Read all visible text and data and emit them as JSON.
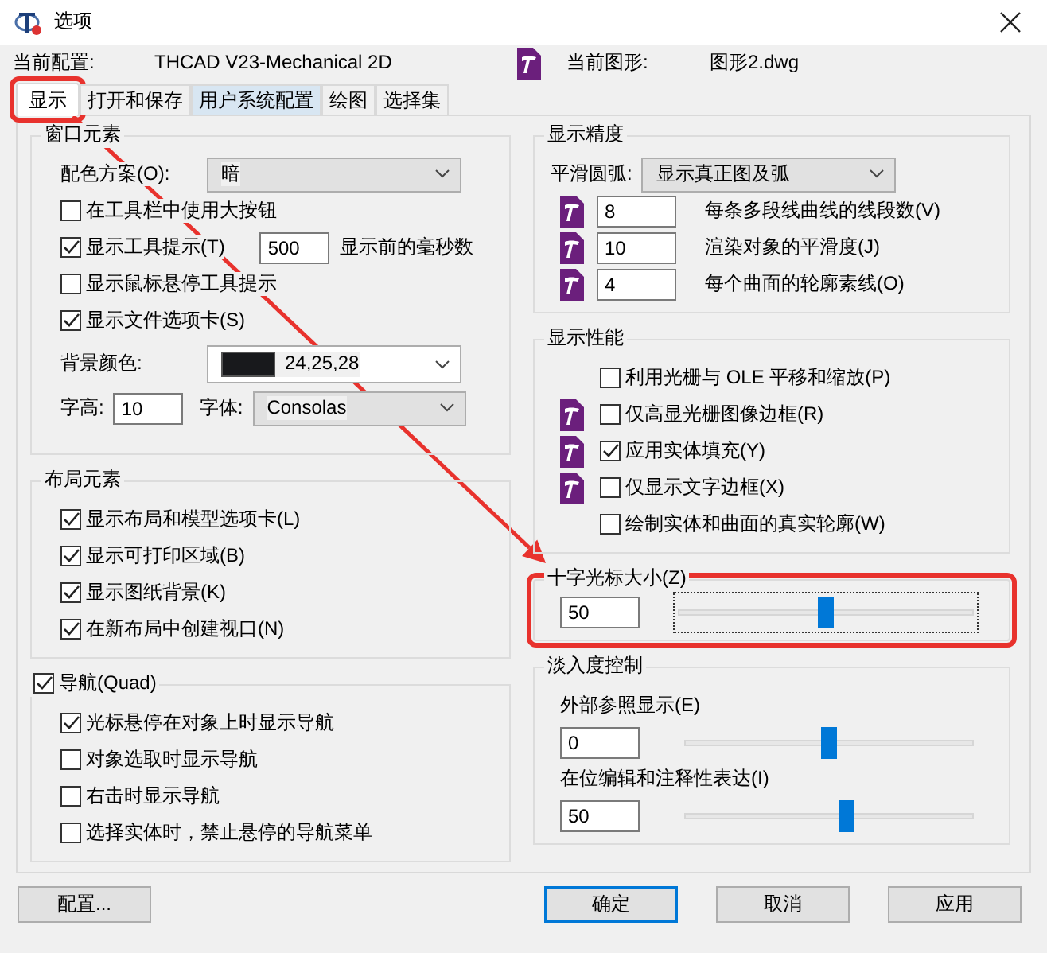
{
  "window": {
    "title": "选项"
  },
  "header": {
    "profile_label": "当前配置:",
    "profile": "THCAD V23-Mechanical 2D",
    "drawing_label": "当前图形:",
    "drawing": "图形2.dwg"
  },
  "tabs": [
    {
      "label": "显示",
      "selected": true,
      "hover": false,
      "highlighted": true
    },
    {
      "label": "打开和保存",
      "selected": false,
      "hover": false,
      "highlighted": false
    },
    {
      "label": "用户系统配置",
      "selected": false,
      "hover": true,
      "highlighted": false
    },
    {
      "label": "绘图",
      "selected": false,
      "hover": false,
      "highlighted": false
    },
    {
      "label": "选择集",
      "selected": false,
      "hover": false,
      "highlighted": false
    }
  ],
  "annotation_arrow": true,
  "window_elements": {
    "title": "窗口元素",
    "color_scheme": {
      "label": "配色方案(O):",
      "value": "暗"
    },
    "options": [
      {
        "label": "在工具栏中使用大按钮",
        "checked": false
      },
      {
        "label": "显示工具提示(T)",
        "checked": true,
        "value": "500",
        "suffix": "显示前的毫秒数"
      },
      {
        "label": "显示鼠标悬停工具提示",
        "checked": false
      },
      {
        "label": "显示文件选项卡(S)",
        "checked": true
      }
    ],
    "background": {
      "label": "背景颜色:",
      "color": "#18191c",
      "value": "24,25,28"
    },
    "font_height": {
      "label": "字高:",
      "value": "10"
    },
    "font": {
      "label": "字体:",
      "value": "Consolas"
    }
  },
  "layout_elements": {
    "title": "布局元素",
    "options": [
      {
        "label": "显示布局和模型选项卡(L)",
        "checked": true
      },
      {
        "label": "显示可打印区域(B)",
        "checked": true
      },
      {
        "label": "显示图纸背景(K)",
        "checked": true
      },
      {
        "label": "在新布局中创建视口(N)",
        "checked": true
      }
    ]
  },
  "navigation": {
    "title": "导航(Quad)",
    "checked": true,
    "options": [
      {
        "label": "光标悬停在对象上时显示导航",
        "checked": true
      },
      {
        "label": "对象选取时显示导航",
        "checked": false
      },
      {
        "label": "右击时显示导航",
        "checked": false
      },
      {
        "label": "选择实体时，禁止悬停的导航菜单",
        "checked": false
      }
    ]
  },
  "display_precision": {
    "title": "显示精度",
    "smooth_arc": {
      "label": "平滑圆弧:",
      "value": "显示真正图及弧"
    },
    "rows": [
      {
        "value": "8",
        "label": "每条多段线曲线的线段数(V)"
      },
      {
        "value": "10",
        "label": "渲染对象的平滑度(J)"
      },
      {
        "value": "4",
        "label": "每个曲面的轮廓素线(O)"
      }
    ]
  },
  "display_performance": {
    "title": "显示性能",
    "options": [
      {
        "label": "利用光栅与 OLE 平移和缩放(P)",
        "checked": false,
        "icon": false
      },
      {
        "label": "仅高显光栅图像边框(R)",
        "checked": false,
        "icon": true
      },
      {
        "label": "应用实体填充(Y)",
        "checked": true,
        "icon": true
      },
      {
        "label": "仅显示文字边框(X)",
        "checked": false,
        "icon": true
      },
      {
        "label": "绘制实体和曲面的真实轮廓(W)",
        "checked": false,
        "icon": false
      }
    ]
  },
  "crosshair": {
    "title": "十字光标大小(Z)",
    "value": "50",
    "level": 0.5,
    "highlighted": true
  },
  "fade_control": {
    "title": "淡入度控制",
    "rows": [
      {
        "label": "外部参照显示(E)",
        "value": "0",
        "level": 0.5
      },
      {
        "label": "在位编辑和注释性表达(I)",
        "value": "50",
        "level": 0.56
      }
    ]
  },
  "buttons": [
    {
      "label": "配置...",
      "default": false
    },
    {
      "label": "确定",
      "default": true
    },
    {
      "label": "取消",
      "default": false
    },
    {
      "label": "应用",
      "default": false
    }
  ]
}
